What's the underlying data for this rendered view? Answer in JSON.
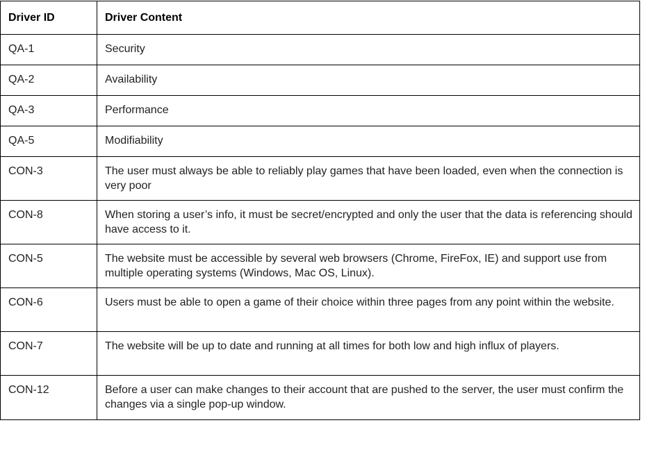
{
  "table": {
    "headers": [
      "Driver ID",
      "Driver Content"
    ],
    "rows": [
      {
        "id": "QA-1",
        "content": "Security"
      },
      {
        "id": "QA-2",
        "content": "Availability"
      },
      {
        "id": "QA-3",
        "content": "Performance"
      },
      {
        "id": "QA-5",
        "content": "Modifiability"
      },
      {
        "id": "CON-3",
        "content": "The user must always be able to reliably play games that have been loaded, even when the connection is very poor"
      },
      {
        "id": "CON-8",
        "content": "When storing a user’s info, it must be secret/encrypted and only the user that the data is referencing should have access to it."
      },
      {
        "id": "CON-5",
        "content": "The website must be accessible by several web browsers (Chrome, FireFox, IE) and support use from multiple operating systems (Windows, Mac OS, Linux)."
      },
      {
        "id": "CON-6",
        "content": "Users must be able to open a game of their choice within three pages from any point within the website."
      },
      {
        "id": "CON-7",
        "content": "The website will be up to date and running at all times for both low and high influx of players."
      },
      {
        "id": "CON-12",
        "content": "Before a user can make changes to their account that are pushed to the server, the user must confirm the changes via a single pop-up window."
      }
    ]
  }
}
